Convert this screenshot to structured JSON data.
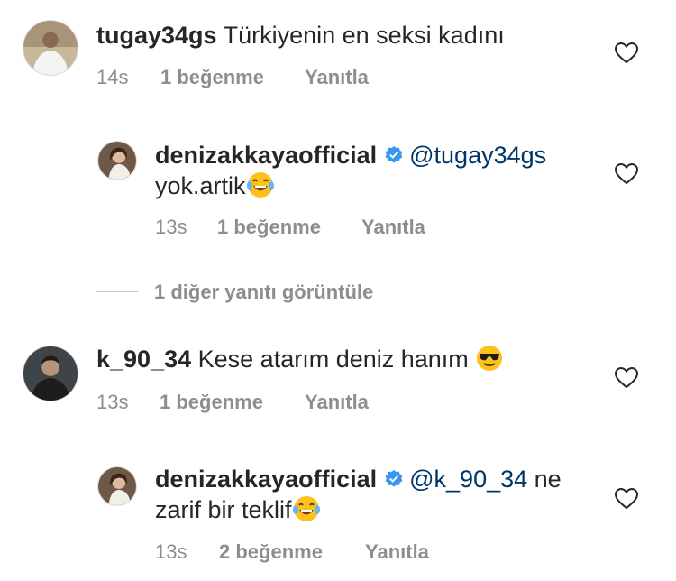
{
  "comments": [
    {
      "username": "tugay34gs",
      "text": "Türkiyenin en seksi kadını",
      "time": "14s",
      "likes": "1 beğenme",
      "reply": "Yanıtla",
      "avatar_icon": "man-white-shirt-avatar"
    },
    {
      "username": "denizakkayaofficial",
      "verified": true,
      "mention": "@tugay34gs",
      "text": "yok.artik",
      "emoji": "face-with-tears-of-joy",
      "time": "13s",
      "likes": "1 beğenme",
      "reply": "Yanıtla",
      "avatar_icon": "woman-avatar"
    },
    {
      "username": "k_90_34",
      "text": "Kese atarım deniz hanım",
      "emoji": "smiling-face-with-sunglasses",
      "time": "13s",
      "likes": "1 beğenme",
      "reply": "Yanıtla",
      "avatar_icon": "man-dark-avatar"
    },
    {
      "username": "denizakkayaofficial",
      "verified": true,
      "mention": "@k_90_34",
      "text_line1": "ne",
      "text_line2": "zarif bir teklif",
      "emoji": "face-with-tears-of-joy",
      "time": "13s",
      "likes": "2 beğenme",
      "reply": "Yanıtla",
      "avatar_icon": "woman-avatar"
    }
  ],
  "view_more_replies": "1 diğer yanıtı görüntüle",
  "colors": {
    "text": "#262626",
    "meta": "#8e8e8e",
    "mention": "#003569",
    "verified": "#3897f0"
  }
}
